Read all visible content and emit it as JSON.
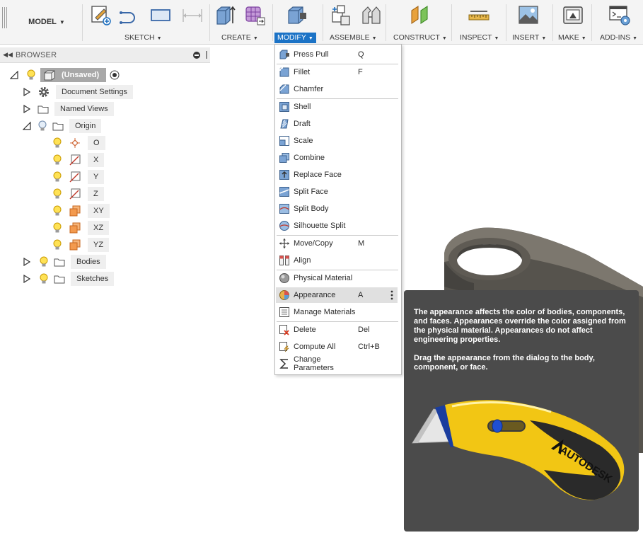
{
  "toolbar": {
    "workspace": "MODEL",
    "groups": [
      {
        "label": "SKETCH",
        "active": false
      },
      {
        "label": "CREATE",
        "active": false
      },
      {
        "label": "MODIFY",
        "active": true
      },
      {
        "label": "ASSEMBLE",
        "active": false
      },
      {
        "label": "CONSTRUCT",
        "active": false
      },
      {
        "label": "INSPECT",
        "active": false
      },
      {
        "label": "INSERT",
        "active": false
      },
      {
        "label": "MAKE",
        "active": false
      },
      {
        "label": "ADD-INS",
        "active": false
      }
    ],
    "accent": "#1c73c6"
  },
  "browser": {
    "title": "BROWSER",
    "root": "(Unsaved)",
    "document_settings": "Document Settings",
    "named_views": "Named Views",
    "origin": {
      "label": "Origin",
      "items": [
        "O",
        "X",
        "Y",
        "Z",
        "XY",
        "XZ",
        "YZ"
      ]
    },
    "bodies": "Bodies",
    "sketches": "Sketches"
  },
  "modify_menu": {
    "items": [
      {
        "label": "Press Pull",
        "shortcut": "Q",
        "icon": "press-pull-icon"
      },
      {
        "label": "Fillet",
        "shortcut": "F",
        "icon": "fillet-icon"
      },
      {
        "label": "Chamfer",
        "shortcut": "",
        "icon": "chamfer-icon"
      },
      {
        "label": "Shell",
        "shortcut": "",
        "icon": "shell-icon"
      },
      {
        "label": "Draft",
        "shortcut": "",
        "icon": "draft-icon"
      },
      {
        "label": "Scale",
        "shortcut": "",
        "icon": "scale-icon"
      },
      {
        "label": "Combine",
        "shortcut": "",
        "icon": "combine-icon"
      },
      {
        "label": "Replace Face",
        "shortcut": "",
        "icon": "replace-face-icon"
      },
      {
        "label": "Split Face",
        "shortcut": "",
        "icon": "split-face-icon"
      },
      {
        "label": "Split Body",
        "shortcut": "",
        "icon": "split-body-icon"
      },
      {
        "label": "Silhouette Split",
        "shortcut": "",
        "icon": "silhouette-split-icon"
      },
      {
        "label": "Move/Copy",
        "shortcut": "M",
        "icon": "move-copy-icon"
      },
      {
        "label": "Align",
        "shortcut": "",
        "icon": "align-icon"
      },
      {
        "label": "Physical Material",
        "shortcut": "",
        "icon": "physical-material-icon"
      },
      {
        "label": "Appearance",
        "shortcut": "A",
        "icon": "appearance-icon"
      },
      {
        "label": "Manage Materials",
        "shortcut": "",
        "icon": "manage-materials-icon"
      },
      {
        "label": "Delete",
        "shortcut": "Del",
        "icon": "delete-icon"
      },
      {
        "label": "Compute All",
        "shortcut": "Ctrl+B",
        "icon": "compute-all-icon"
      },
      {
        "label": "Change Parameters",
        "shortcut": "",
        "icon": "change-parameters-icon"
      }
    ],
    "highlighted": "Appearance"
  },
  "tooltip": {
    "paragraph1": "The appearance affects the color of bodies, components, and faces. Appearances override the color assigned from the physical material. Appearances do not affect engineering properties.",
    "paragraph2": "Drag the appearance from the dialog to the body, component, or face.",
    "brand": "AUTODESK"
  }
}
